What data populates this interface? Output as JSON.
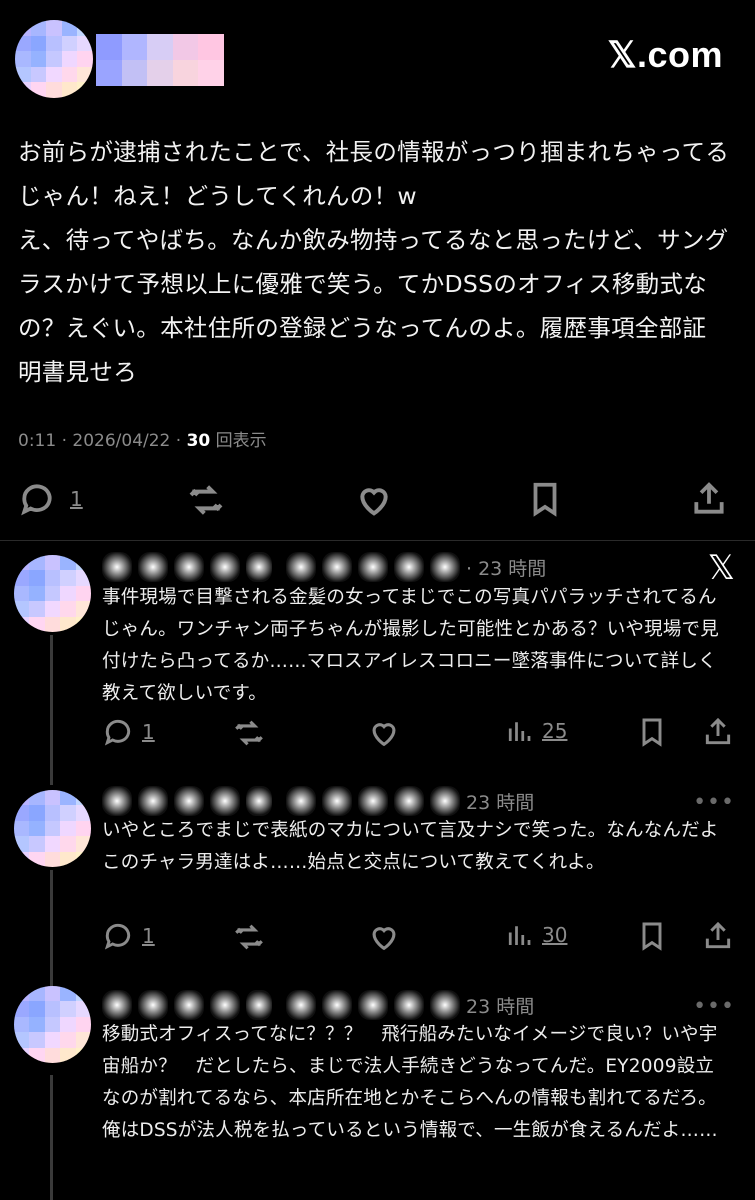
{
  "brand": "𝕏.com",
  "post": {
    "text": "お前らが逮捕されたことで、社長の情報がっつり掴まれちゃってるじゃん！ねえ！どうしてくれんの！w\nえ、待ってやばち。なんか飲み物持ってるなと思ったけど、サングラスかけて予想以上に優雅で笑う。てかDSSのオフィス移動式なの？えぐい。本社住所の登録どうなってんのよ。履歴事項全部証明書見せろ",
    "time": "0:11 · 2026/04/22 · ",
    "views_count": "30",
    "views_label": " 回表示",
    "reply_count": "1"
  },
  "replies": [
    {
      "time": "· 23 時間",
      "text": "事件現場で目撃される金髪の女ってまじでこの写真パパラッチされてるんじゃん。ワンチャン両子ちゃんが撮影した可能性とかある？いや現場で見付けたら凸ってるか……マロスアイレスコロニー墜落事件について詳しく教えて欲しいです。",
      "reply_count": "1",
      "views": "25",
      "corner": "𝕏"
    },
    {
      "time": "23 時間",
      "text": "いやところでまじで表紙のマカについて言及ナシで笑った。なんなんだよこのチャラ男達はよ……始点と交点について教えてくれよ。",
      "reply_count": "1",
      "views": "30",
      "corner": "•••"
    },
    {
      "time": "23 時間",
      "text": "移動式オフィスってなに？？？　飛行船みたいなイメージで良い？いや宇宙船か？　だとしたら、まじで法人手続きどうなってんだ。EY2009設立なのが割れてるなら、本店所在地とかそこらへんの情報も割れてるだろ。俺はDSSが法人税を払っているという情報で、一生飯が食えるんだよ……",
      "corner": "•••"
    }
  ]
}
